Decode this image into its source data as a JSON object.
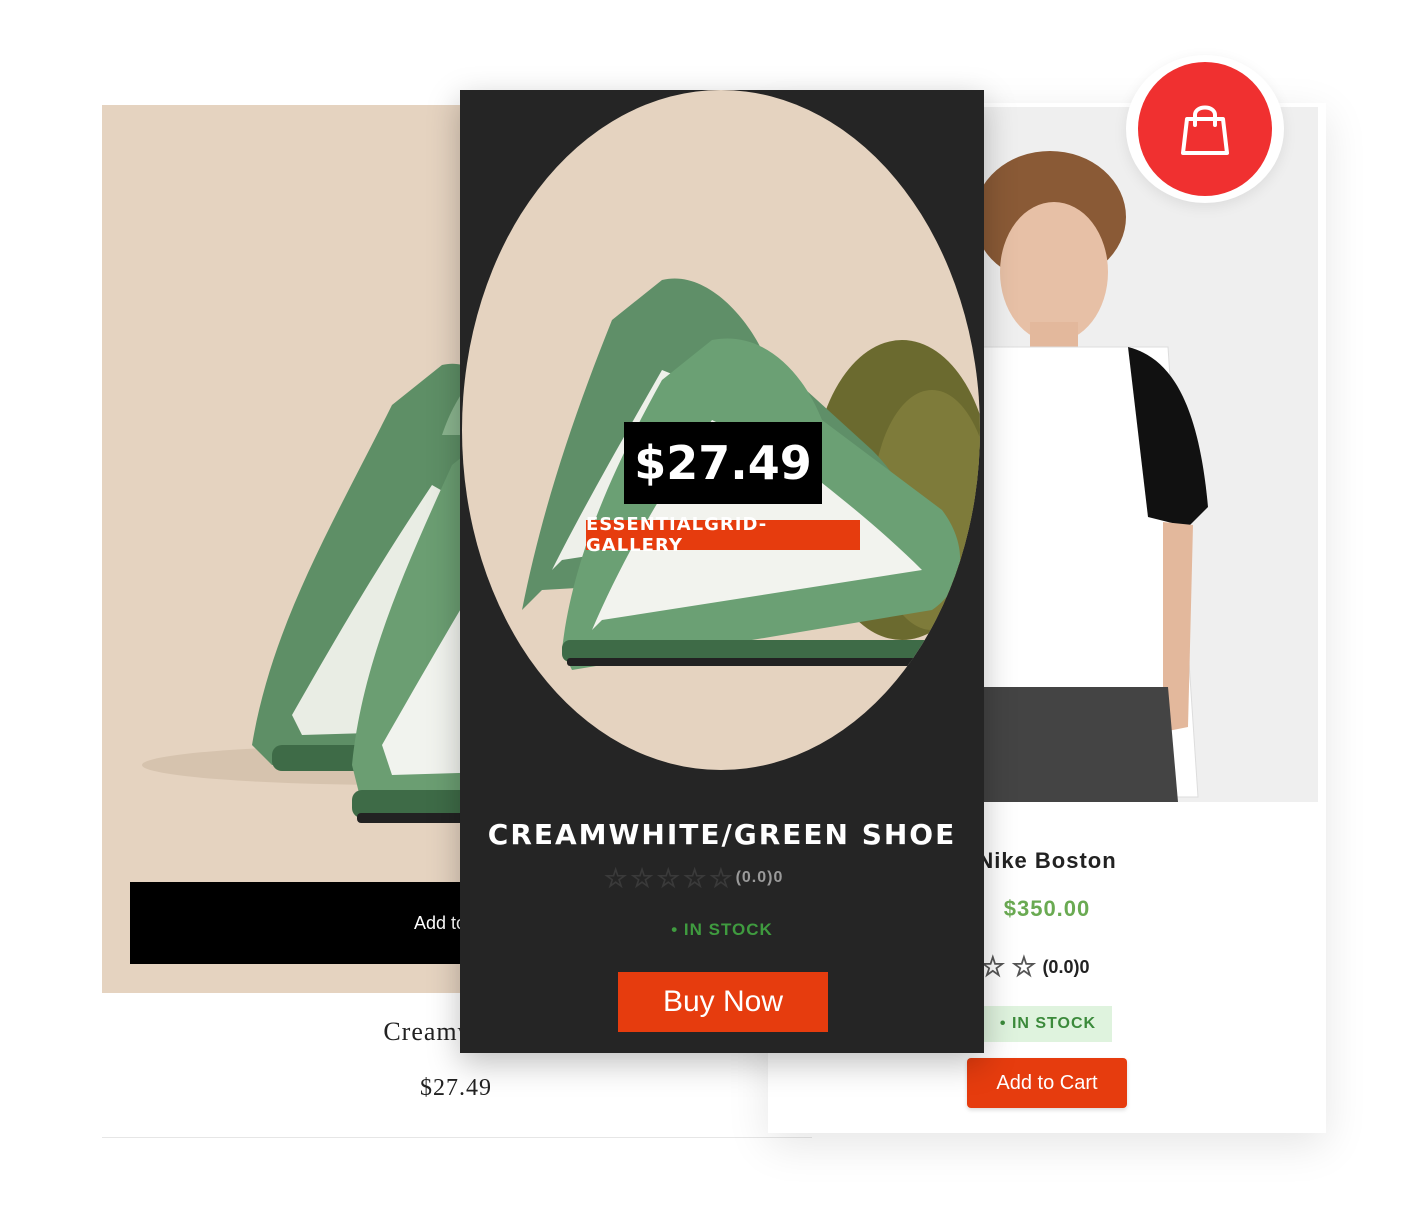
{
  "left_card": {
    "add_label": "Add to",
    "title": "Creamwhite/",
    "price": "$27.49"
  },
  "middle_card": {
    "price_tag": "$27.49",
    "category_tag": "ESSENTIALGRID-GALLERY",
    "title": "CREAMWHITE/GREEN SHOE",
    "rating_text": "(0.0)0",
    "stock": "• IN STOCK",
    "buy_label": "Buy Now"
  },
  "right_card": {
    "name": "Nike Boston",
    "price": "$350.00",
    "rating_text": "(0.0)0",
    "stock": "• IN STOCK",
    "add_label": "Add to Cart"
  },
  "badge": {
    "icon": "shopping-bag-icon"
  },
  "colors": {
    "accent": "#e63c0e",
    "badge_red": "#f03030",
    "price_green": "#6aaa52",
    "stock_green": "#3b8a3b",
    "dark_card": "#252525",
    "beige": "#e5d3c0"
  }
}
